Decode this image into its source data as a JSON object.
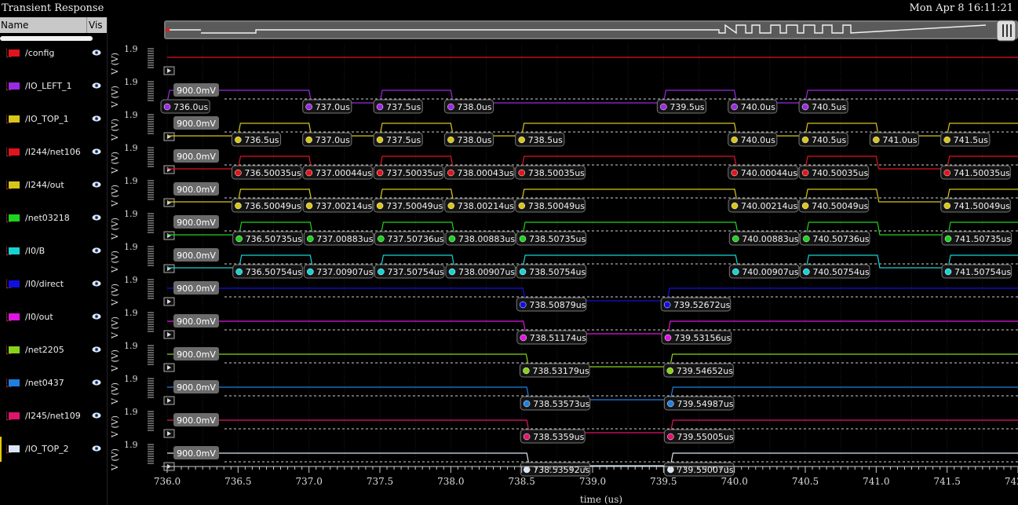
{
  "window": {
    "title": "Transient Response",
    "datetime": "Mon Apr 8 16:11:21"
  },
  "sidebar": {
    "header": {
      "name": "Name",
      "vis": "Vis"
    },
    "signals": [
      {
        "label": "/config",
        "color": "#e0141c"
      },
      {
        "label": "/IO_LEFT_1",
        "color": "#9a2be0"
      },
      {
        "label": "/IO_TOP_1",
        "color": "#d7c619"
      },
      {
        "label": "/I244/net106",
        "color": "#e0141c"
      },
      {
        "label": "/I244/out",
        "color": "#d7c619"
      },
      {
        "label": "/net03218",
        "color": "#1fd21f"
      },
      {
        "label": "/I0/B",
        "color": "#16d3d3"
      },
      {
        "label": "/I0/direct",
        "color": "#1010e0"
      },
      {
        "label": "/I0/out",
        "color": "#e014e0"
      },
      {
        "label": "/net2205",
        "color": "#86d318"
      },
      {
        "label": "/net0437",
        "color": "#1f7fe0"
      },
      {
        "label": "/I245/net109",
        "color": "#e0146e"
      },
      {
        "label": "/IO_TOP_2",
        "color": "#d9e6f7"
      }
    ]
  },
  "chart_data": {
    "type": "line",
    "title": "",
    "xlabel": "time (us)",
    "ylabel": "V (V)",
    "xlim": [
      736.0,
      742.0
    ],
    "x_ticks": [
      "736.0",
      "736.5",
      "737.0",
      "737.5",
      "738.0",
      "738.5",
      "739.0",
      "739.5",
      "740.0",
      "740.5",
      "741.0",
      "741.5",
      "742.0"
    ],
    "strip_ymax_label": "1.9",
    "cursor_label": "900.0mV",
    "strips": [
      {
        "signal": "/config",
        "initial": 1,
        "transitions": [],
        "markers": []
      },
      {
        "signal": "/IO_LEFT_1",
        "initial": 0,
        "transitions": [
          736.0,
          737.0,
          737.5,
          738.0,
          739.5,
          740.0,
          740.5
        ],
        "markers": [
          "736.0us",
          "737.0us",
          "737.5us",
          "738.0us",
          "739.5us",
          "740.0us",
          "740.5us"
        ]
      },
      {
        "signal": "/IO_TOP_1",
        "initial": 0,
        "transitions": [
          736.5,
          737.0,
          737.5,
          738.0,
          738.5,
          740.0,
          740.5,
          741.0,
          741.5
        ],
        "markers": [
          "736.5us",
          "737.0us",
          "737.5us",
          "738.0us",
          "738.5us",
          "740.0us",
          "740.5us",
          "741.0us",
          "741.5us"
        ]
      },
      {
        "signal": "/I244/net106",
        "initial": 0,
        "transitions": [
          736.50035,
          737.00044,
          737.50035,
          738.00043,
          738.50035,
          740.00044,
          740.50035,
          741.00044,
          741.50035
        ],
        "markers": [
          "736.50035us",
          "737.00044us",
          "737.50035us",
          "738.00043us",
          "738.50035us",
          "740.00044us",
          "740.50035us",
          "741.50035us"
        ]
      },
      {
        "signal": "/I244/out",
        "initial": 0,
        "transitions": [
          736.50049,
          737.00214,
          737.50049,
          738.00214,
          738.50049,
          740.00214,
          740.50049,
          741.00214,
          741.50049
        ],
        "markers": [
          "736.50049us",
          "737.00214us",
          "737.50049us",
          "738.00214us",
          "738.50049us",
          "740.00214us",
          "740.50049us",
          "741.50049us"
        ]
      },
      {
        "signal": "/net03218",
        "initial": 0,
        "transitions": [
          736.50735,
          737.00883,
          737.50736,
          738.00883,
          738.50735,
          740.00883,
          740.50736,
          741.00883,
          741.50735
        ],
        "markers": [
          "736.50735us",
          "737.00883us",
          "737.50736us",
          "738.00883us",
          "738.50735us",
          "740.00883us",
          "740.50736us",
          "741.50735us"
        ]
      },
      {
        "signal": "/I0/B",
        "initial": 0,
        "transitions": [
          736.50754,
          737.00907,
          737.50754,
          738.00907,
          738.50754,
          740.00907,
          740.50754,
          741.00907,
          741.50754
        ],
        "markers": [
          "736.50754us",
          "737.00907us",
          "737.50754us",
          "738.00907us",
          "738.50754us",
          "740.00907us",
          "740.50754us",
          "741.50754us"
        ]
      },
      {
        "signal": "/I0/direct",
        "initial": 1,
        "transitions": [
          738.50879,
          739.52672
        ],
        "markers": [
          "738.50879us",
          "739.52672us"
        ]
      },
      {
        "signal": "/I0/out",
        "initial": 1,
        "transitions": [
          738.51174,
          739.53156
        ],
        "markers": [
          "738.51174us",
          "739.53156us"
        ]
      },
      {
        "signal": "/net2205",
        "initial": 1,
        "transitions": [
          738.53179,
          739.54652
        ],
        "markers": [
          "738.53179us",
          "739.54652us"
        ]
      },
      {
        "signal": "/net0437",
        "initial": 1,
        "transitions": [
          738.53573,
          739.54987
        ],
        "markers": [
          "738.53573us",
          "739.54987us"
        ]
      },
      {
        "signal": "/I245/net109",
        "initial": 1,
        "transitions": [
          738.5359,
          739.55005
        ],
        "markers": [
          "738.5359us",
          "739.55005us"
        ]
      },
      {
        "signal": "/IO_TOP_2",
        "initial": 1,
        "transitions": [
          738.53592,
          739.55007
        ],
        "markers": [
          "738.53592us",
          "739.55007us"
        ]
      }
    ]
  }
}
